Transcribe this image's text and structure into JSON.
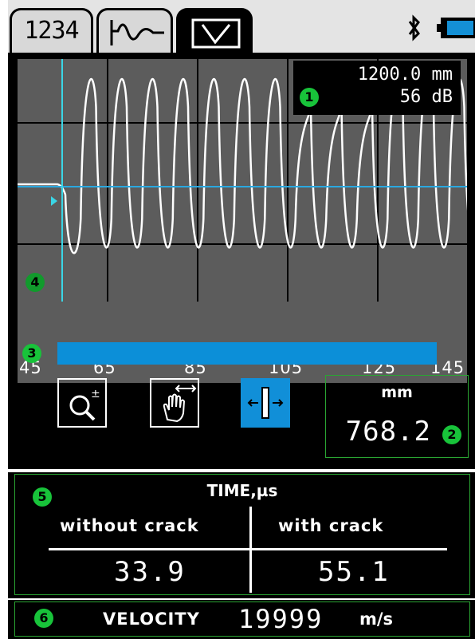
{
  "tabs": [
    {
      "label": "1234",
      "icon": "digits-tab-icon",
      "active": false
    },
    {
      "label": "",
      "icon": "waveform-tab-icon",
      "active": false
    },
    {
      "label": "",
      "icon": "rectangular-pulse-tab-icon",
      "active": true
    }
  ],
  "status": {
    "bluetooth_icon": "bluetooth-icon",
    "battery_icon": "battery-icon"
  },
  "readout": {
    "range": "1200.0 mm",
    "gain": "56 dB"
  },
  "markers": [
    "1",
    "2",
    "3",
    "4",
    "5",
    "6"
  ],
  "axis": {
    "ticks": [
      "45",
      "65",
      "85",
      "105",
      "125",
      "145"
    ]
  },
  "progress": {
    "level": 0.9
  },
  "tools": [
    "zoom-button",
    "pan-button",
    "gate-button"
  ],
  "measure": {
    "unit": "mm",
    "value": "768.2"
  },
  "time": {
    "title": "TIME,µs",
    "without_label": "without crack",
    "with_label": "with crack",
    "without_value": "33.9",
    "with_value": "55.1"
  },
  "velocity": {
    "label": "VELOCITY",
    "value": "19999",
    "unit": "m/s"
  },
  "colors": {
    "accent": "#118fd8",
    "marker": "#18c33a",
    "cursor": "#3ad6e6",
    "grid": "#5c5c5c"
  }
}
